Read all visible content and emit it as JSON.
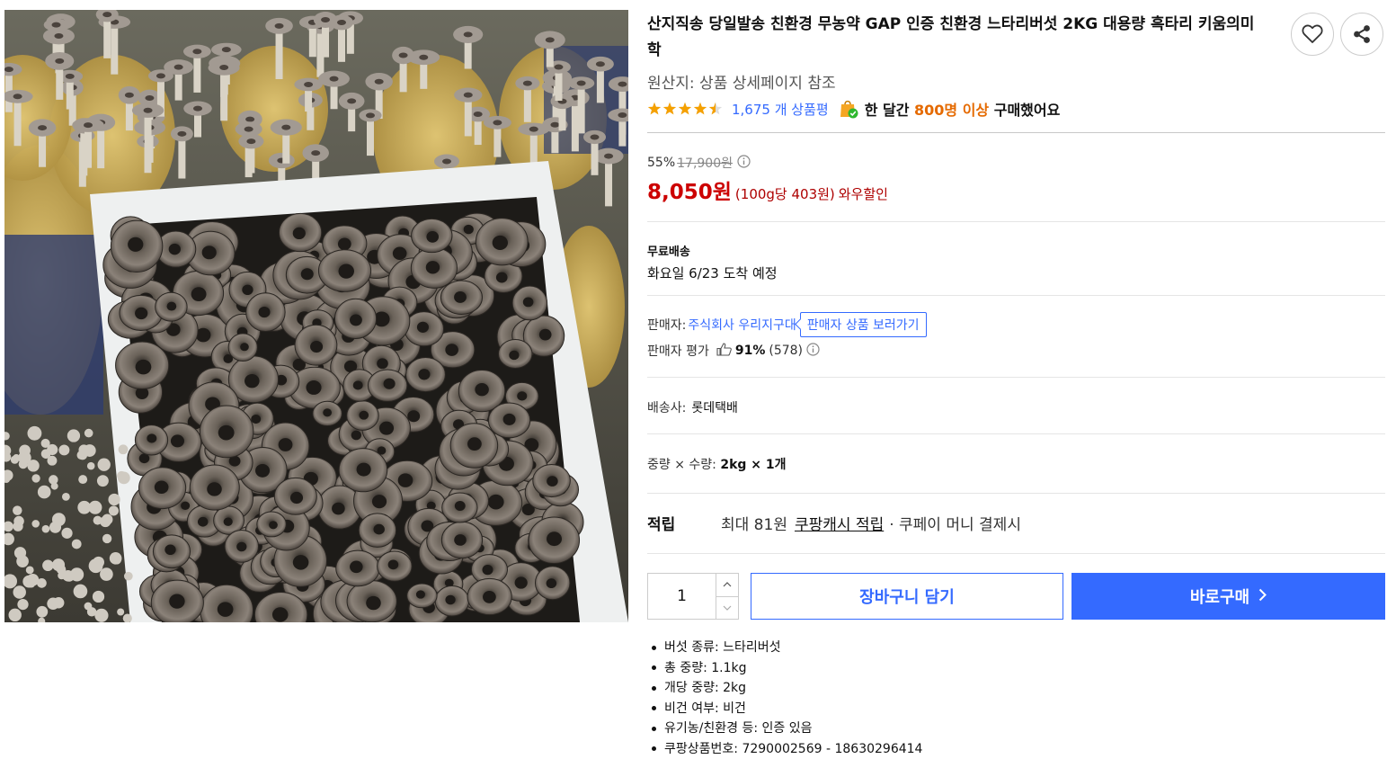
{
  "product": {
    "title": "산지직송 당일발송 친환경 무농약 GAP 인증 친환경 느타리버섯 2KG 대용량 흑타리 키움의미학",
    "image_icon": "black-oyster-mushroom-photo",
    "origin": "원산지: 상품 상세페이지 참조",
    "rating_stars": 4.5,
    "review_count": "1,675 개 상품평",
    "buy_text_prefix": "한 달간",
    "buy_text_count": "800명 이상",
    "buy_text_suffix": "구매했어요"
  },
  "price": {
    "discount_rate": "55%",
    "original_price": "17,900원",
    "sale_price": "8,050원",
    "unit_price": "(100g당 403원)",
    "wow_label": "와우할인"
  },
  "shipping": {
    "label": "무료배송",
    "arrival": "화요일 6/23 도착 예정"
  },
  "seller": {
    "label": "판매자:",
    "name": "주식회사 우리지구대",
    "link_label": "판매자 상품 보러가기",
    "rating_label": "판매자 평가",
    "rating_pct": "91%",
    "rating_count": "(578)"
  },
  "courier": {
    "label": "배송사:",
    "value": "롯데택배"
  },
  "option": {
    "label": "중량 × 수량:",
    "value": "2kg × 1개"
  },
  "points": {
    "label": "적립",
    "max": "최대 81원",
    "cash": "쿠팡캐시 적립",
    "pay": "· 쿠페이 머니 결제시"
  },
  "purchase": {
    "quantity": "1",
    "cart_label": "장바구니 담기",
    "buy_label": "바로구매",
    "accent_color": "#346aff"
  },
  "attributes": [
    "버섯 종류: 느타리버섯",
    "총 중량: 1.1kg",
    "개당 중량: 2kg",
    "비건 여부: 비건",
    "유기농/친환경 등: 인증 있음",
    "쿠팡상품번호: 7290002569 - 18630296414"
  ]
}
